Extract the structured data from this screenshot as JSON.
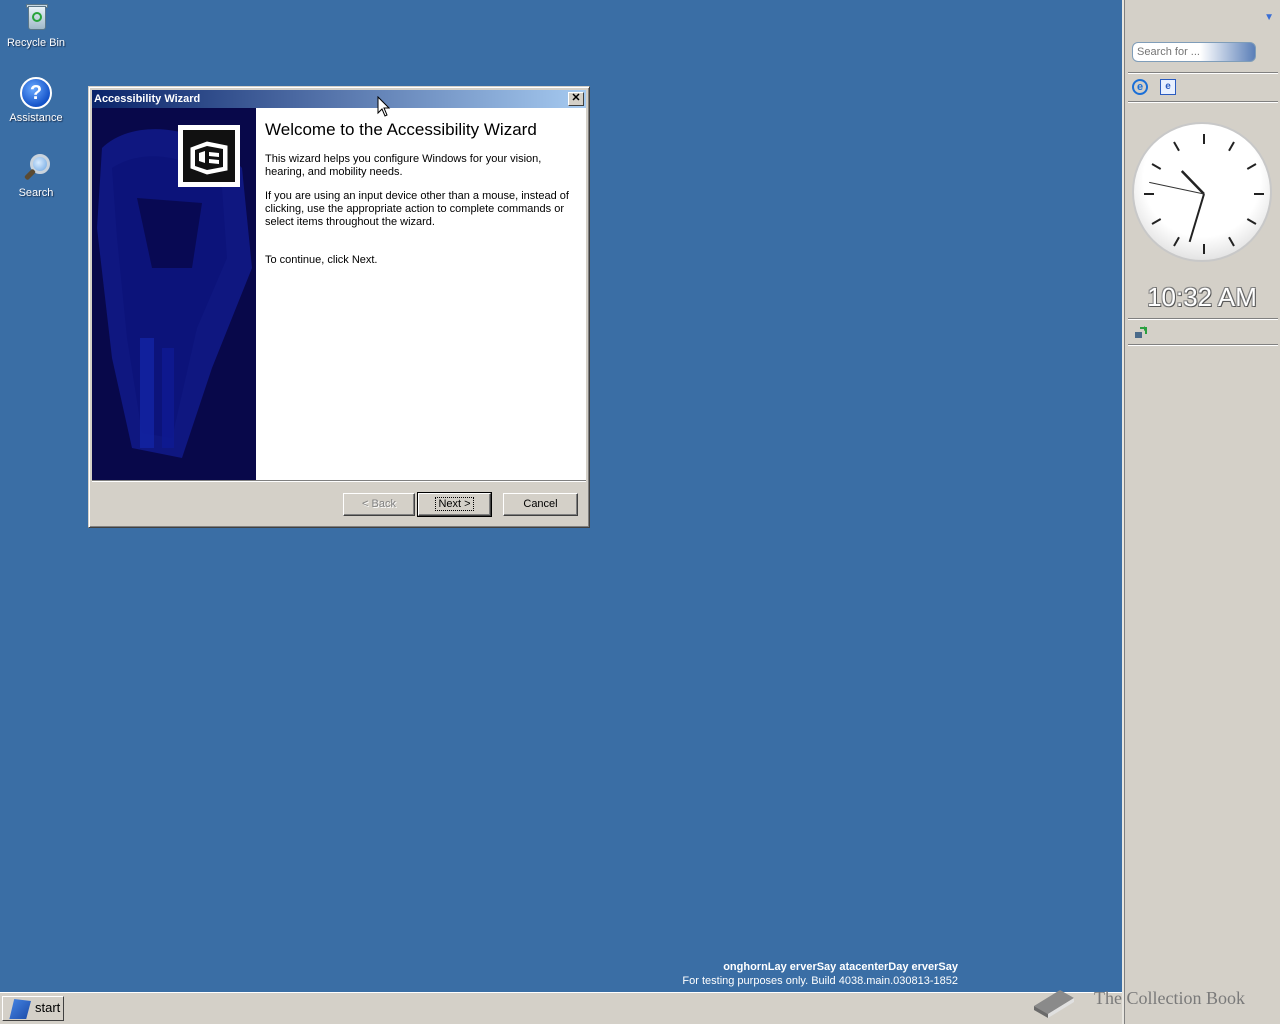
{
  "desktop": {
    "icons": [
      {
        "label": "Recycle Bin",
        "icon": "recycle-bin-icon"
      },
      {
        "label": "Assistance",
        "icon": "help-icon"
      },
      {
        "label": "Search",
        "icon": "search-icon"
      }
    ]
  },
  "dialog": {
    "title": "Accessibility Wizard",
    "close_glyph": "✕",
    "heading": "Welcome to the Accessibility Wizard",
    "paragraphs": [
      "This wizard helps you configure Windows for your vision, hearing, and mobility needs.",
      "If you are using an input device other than a mouse, instead of clicking, use the appropriate action to complete commands or select items throughout the wizard.",
      "To continue, click Next."
    ],
    "buttons": {
      "back": "< Back",
      "next": "Next >",
      "cancel": "Cancel"
    }
  },
  "sidebar": {
    "search_placeholder": "Search for ...",
    "clock_time": "10:32 AM",
    "clock": {
      "hour": 10,
      "minute": 32,
      "second": 47
    }
  },
  "watermark": {
    "title": "onghornLay erverSay atacenterDay erverSay",
    "build": "For testing purposes only. Build 4038.main.030813-1852"
  },
  "taskbar": {
    "start_label": "start"
  },
  "brand": {
    "text": "The Collection Book"
  }
}
